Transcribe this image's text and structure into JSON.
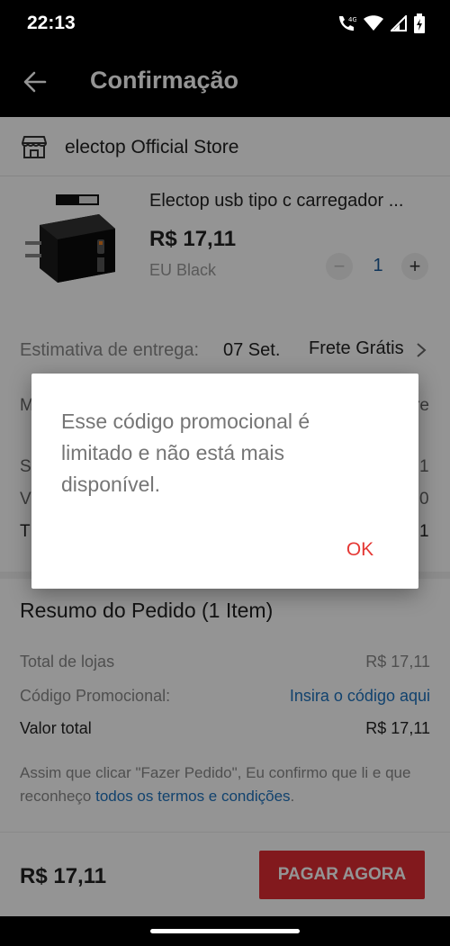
{
  "status_bar": {
    "time": "22:13",
    "network": "4G",
    "icons": [
      "call-icon",
      "wifi-icon",
      "signal-icon",
      "battery-icon"
    ]
  },
  "app_bar": {
    "title": "Confirmação",
    "back_icon": "arrow-left-icon"
  },
  "store": {
    "name": "electop Official Store",
    "icon": "store-icon"
  },
  "product": {
    "title": "Electop usb tipo c carregador ...",
    "price": "R$ 17,11",
    "variant": "EU Black",
    "quantity": "1",
    "minus_label": "−",
    "plus_label": "+"
  },
  "delivery": {
    "label": "Estimativa de entrega:",
    "date": "07 Set.",
    "shipping": "Frete Grátis"
  },
  "partial_rows": {
    "a": "M",
    "b": "S",
    "c": "V",
    "d": "T",
    "e": "re",
    "f": "1",
    "g": "0",
    "h": "1"
  },
  "summary": {
    "title": "Resumo do Pedido (1 Item)",
    "rows": [
      {
        "label": "Total de lojas",
        "value": "R$ 17,11"
      },
      {
        "label": "Código Promocional:",
        "value": "Insira o código aqui"
      },
      {
        "label": "Valor total",
        "value": "R$ 17,11"
      }
    ]
  },
  "terms": {
    "text": "Assim que clicar \"Fazer Pedido\", Eu confirmo que li e que reconheço ",
    "link": "todos os termos e condições",
    "end": "."
  },
  "bottom_bar": {
    "total": "R$ 17,11",
    "pay_label": "PAGAR AGORA"
  },
  "dialog": {
    "message": "Esse código promocional é limitado e não está mais disponível.",
    "ok_label": "OK"
  },
  "colors": {
    "accent": "#e02b33",
    "dialog_ok": "#e53935",
    "link": "#1e73be"
  }
}
